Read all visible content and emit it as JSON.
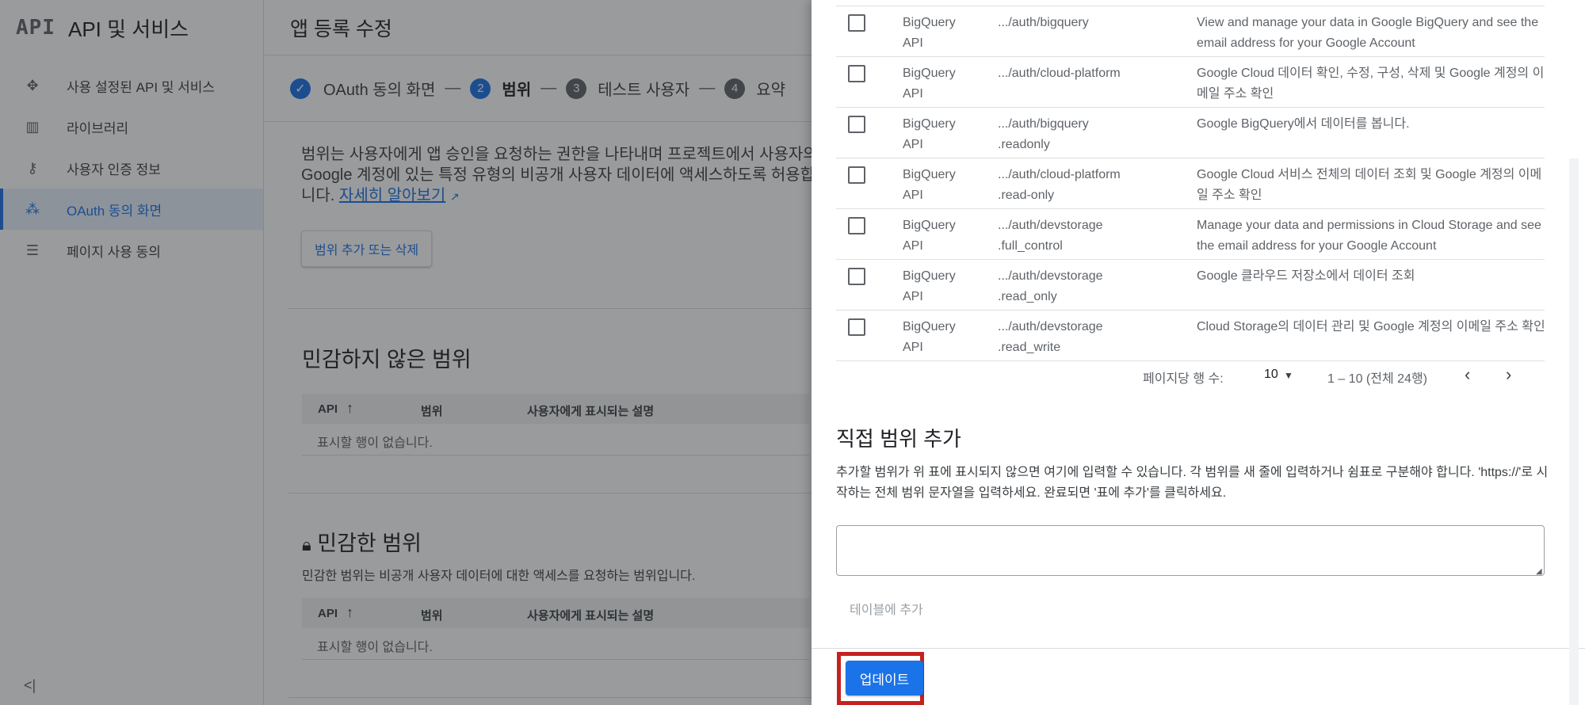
{
  "sidebar": {
    "logo": "API",
    "title": "API 및 서비스",
    "items": [
      {
        "label": "사용 설정된 API 및 서비스",
        "icon": "hub-icon"
      },
      {
        "label": "라이브러리",
        "icon": "library-icon"
      },
      {
        "label": "사용자 인증 정보",
        "icon": "key-icon"
      },
      {
        "label": "OAuth 동의 화면",
        "icon": "oauth-icon"
      },
      {
        "label": "페이지 사용 동의",
        "icon": "settings-list-icon"
      }
    ],
    "collapse": "<|"
  },
  "header": {
    "title": "앱 등록 수정"
  },
  "stepper": {
    "steps": [
      {
        "label": "OAuth 동의 화면"
      },
      {
        "num": "2",
        "label": "범위"
      },
      {
        "num": "3",
        "label": "테스트 사용자"
      },
      {
        "num": "4",
        "label": "요약"
      }
    ],
    "sep": "—"
  },
  "scopes_page": {
    "description": "범위는 사용자에게 앱 승인을 요청하는 권한을 나타내며 프로젝트에서 사용자의 Google 계정에 있는 특정 유형의 비공개 사용자 데이터에 액세스하도록 허용합니다.",
    "learn_more": "자세히 알아보기",
    "add_remove_button": "범위 추가 또는 삭제",
    "non_sensitive_title": "민감하지 않은 범위",
    "sensitive_title": "민감한 범위",
    "sensitive_desc": "민감한 범위는 비공개 사용자 데이터에 대한 액세스를 요청하는 범위입니다.",
    "table_headers": {
      "api": "API",
      "scope": "범위",
      "user_desc": "사용자에게 표시되는 설명"
    },
    "empty": "표시할 행이 없습니다."
  },
  "panel": {
    "rows": [
      {
        "api": "BigQuery API",
        "scope_line1": ".../auth/bigquery",
        "scope_line2": "",
        "desc": "View and manage your data in Google BigQuery and see the email address for your Google Account"
      },
      {
        "api": "BigQuery API",
        "scope_line1": ".../auth/cloud-platform",
        "scope_line2": "",
        "desc": "Google Cloud 데이터 확인, 수정, 구성, 삭제 및 Google 계정의 이메일 주소 확인"
      },
      {
        "api": "BigQuery API",
        "scope_line1": ".../auth/bigquery",
        "scope_line2": ".readonly",
        "desc": "Google BigQuery에서 데이터를 봅니다."
      },
      {
        "api": "BigQuery API",
        "scope_line1": ".../auth/cloud-platform",
        "scope_line2": ".read-only",
        "desc": "Google Cloud 서비스 전체의 데이터 조회 및 Google 계정의 이메일 주소 확인"
      },
      {
        "api": "BigQuery API",
        "scope_line1": ".../auth/devstorage",
        "scope_line2": ".full_control",
        "desc": "Manage your data and permissions in Cloud Storage and see the email address for your Google Account"
      },
      {
        "api": "BigQuery API",
        "scope_line1": ".../auth/devstorage",
        "scope_line2": ".read_only",
        "desc": "Google 클라우드 저장소에서 데이터 조회"
      },
      {
        "api": "BigQuery API",
        "scope_line1": ".../auth/devstorage",
        "scope_line2": ".read_write",
        "desc": "Cloud Storage의 데이터 관리 및 Google 계정의 이메일 주소 확인"
      }
    ],
    "pager": {
      "rows_per_page_label": "페이지당 행 수:",
      "rows_per_page_value": "10",
      "range": "1 – 10 (전체 24행)"
    },
    "manual": {
      "title": "직접 범위 추가",
      "desc": "추가할 범위가 위 표에 표시되지 않으면 여기에 입력할 수 있습니다. 각 범위를 새 줄에 입력하거나 쉼표로 구분해야 합니다. 'https://'로 시작하는 전체 범위 문자열을 입력하세요. 완료되면 '표에 추가'를 클릭하세요.",
      "input_value": "",
      "add_button": "테이블에 추가"
    },
    "update_button": "업데이트"
  },
  "colors": {
    "accent": "#1a73e8",
    "highlight": "#c5221f"
  }
}
